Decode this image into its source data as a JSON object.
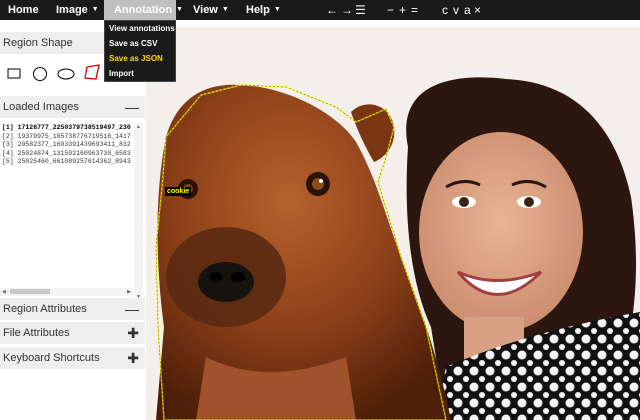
{
  "menubar": {
    "home": "Home",
    "image": "Image",
    "annotation": "Annotation",
    "view": "View",
    "help": "Help",
    "arrow": "▼"
  },
  "toolbar": {
    "prev": "←",
    "next": "→",
    "list": "☰",
    "zoom_out": "−",
    "zoom_reset": "+",
    "zoom_in": "=",
    "copy": "c",
    "paste": "v",
    "select_all": "a",
    "delete": "×"
  },
  "annotation_menu": {
    "items": [
      "View annotations",
      "Save as CSV",
      "Save as JSON",
      "Import"
    ],
    "highlighted": "Save as JSON"
  },
  "panel": {
    "region_shape": "Region Shape",
    "loaded_images": "Loaded Images",
    "region_attributes": "Region Attributes",
    "file_attributes": "File Attributes",
    "keyboard_shortcuts": "Keyboard Shortcuts",
    "collapse_symbol": "—",
    "expand_symbol": "✚"
  },
  "shapes": [
    "rectangle-icon",
    "circle-icon",
    "ellipse-icon",
    "polygon-icon"
  ],
  "images": [
    "[1] 17126777_2250379738519497_230",
    "[2] 19379975_1057387767195­16_1417",
    "[3] 20582377_1603391439693411_832",
    "[4] 25024874_1315921609637­30_6583",
    "[5] 25025460_6610892576143­62_8943"
  ],
  "canvas": {
    "region_label": "cookie"
  },
  "colors": {
    "menubar": "#1a1a1a",
    "active_menu": "#bfbfbf",
    "highlight": "#ffd700",
    "polygon_outline": "#ffff00"
  }
}
